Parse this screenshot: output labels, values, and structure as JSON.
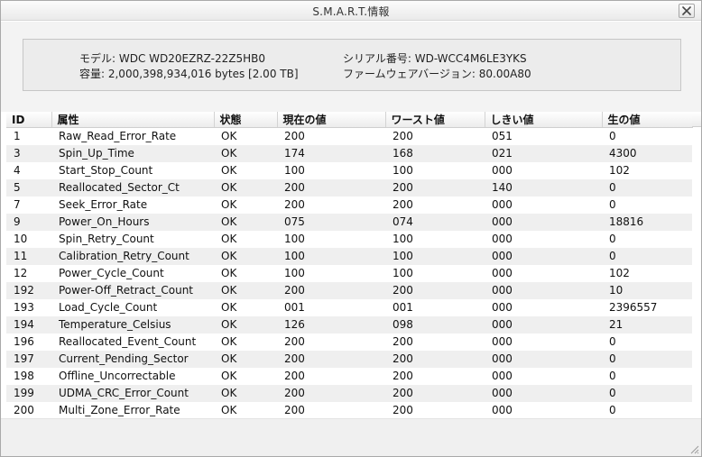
{
  "window": {
    "title": "S.M.A.R.T.情報"
  },
  "info": {
    "model": "モデル: WDC WD20EZRZ-22Z5HB0",
    "capacity": "容量: 2,000,398,934,016 bytes [2.00 TB]",
    "serial": "シリアル番号: WD-WCC4M6LE3YKS",
    "firmware": "ファームウェアバージョン: 80.00A80"
  },
  "table": {
    "headers": {
      "id": "ID",
      "attr": "属性",
      "status": "状態",
      "current": "現在の値",
      "worst": "ワースト値",
      "threshold": "しきい値",
      "raw": "生の値"
    },
    "rows": [
      {
        "id": "1",
        "attr": "Raw_Read_Error_Rate",
        "status": "OK",
        "current": "200",
        "worst": "200",
        "threshold": "051",
        "raw": "0"
      },
      {
        "id": "3",
        "attr": "Spin_Up_Time",
        "status": "OK",
        "current": "174",
        "worst": "168",
        "threshold": "021",
        "raw": "4300"
      },
      {
        "id": "4",
        "attr": "Start_Stop_Count",
        "status": "OK",
        "current": "100",
        "worst": "100",
        "threshold": "000",
        "raw": "102"
      },
      {
        "id": "5",
        "attr": "Reallocated_Sector_Ct",
        "status": "OK",
        "current": "200",
        "worst": "200",
        "threshold": "140",
        "raw": "0"
      },
      {
        "id": "7",
        "attr": "Seek_Error_Rate",
        "status": "OK",
        "current": "200",
        "worst": "200",
        "threshold": "000",
        "raw": "0"
      },
      {
        "id": "9",
        "attr": "Power_On_Hours",
        "status": "OK",
        "current": "075",
        "worst": "074",
        "threshold": "000",
        "raw": "18816"
      },
      {
        "id": "10",
        "attr": "Spin_Retry_Count",
        "status": "OK",
        "current": "100",
        "worst": "100",
        "threshold": "000",
        "raw": "0"
      },
      {
        "id": "11",
        "attr": "Calibration_Retry_Count",
        "status": "OK",
        "current": "100",
        "worst": "100",
        "threshold": "000",
        "raw": "0"
      },
      {
        "id": "12",
        "attr": "Power_Cycle_Count",
        "status": "OK",
        "current": "100",
        "worst": "100",
        "threshold": "000",
        "raw": "102"
      },
      {
        "id": "192",
        "attr": "Power-Off_Retract_Count",
        "status": "OK",
        "current": "200",
        "worst": "200",
        "threshold": "000",
        "raw": "10"
      },
      {
        "id": "193",
        "attr": "Load_Cycle_Count",
        "status": "OK",
        "current": "001",
        "worst": "001",
        "threshold": "000",
        "raw": "2396557"
      },
      {
        "id": "194",
        "attr": "Temperature_Celsius",
        "status": "OK",
        "current": "126",
        "worst": "098",
        "threshold": "000",
        "raw": "21"
      },
      {
        "id": "196",
        "attr": "Reallocated_Event_Count",
        "status": "OK",
        "current": "200",
        "worst": "200",
        "threshold": "000",
        "raw": "0"
      },
      {
        "id": "197",
        "attr": "Current_Pending_Sector",
        "status": "OK",
        "current": "200",
        "worst": "200",
        "threshold": "000",
        "raw": "0"
      },
      {
        "id": "198",
        "attr": "Offline_Uncorrectable",
        "status": "OK",
        "current": "200",
        "worst": "200",
        "threshold": "000",
        "raw": "0"
      },
      {
        "id": "199",
        "attr": "UDMA_CRC_Error_Count",
        "status": "OK",
        "current": "200",
        "worst": "200",
        "threshold": "000",
        "raw": "0"
      },
      {
        "id": "200",
        "attr": "Multi_Zone_Error_Rate",
        "status": "OK",
        "current": "200",
        "worst": "200",
        "threshold": "000",
        "raw": "0"
      }
    ]
  },
  "icons": {
    "close": "close-icon",
    "resize": "resize-grip-icon"
  },
  "colors": {
    "row_alt": "#efefef",
    "header_bg": "#ececec",
    "panel_bg": "#f3f3f3"
  }
}
